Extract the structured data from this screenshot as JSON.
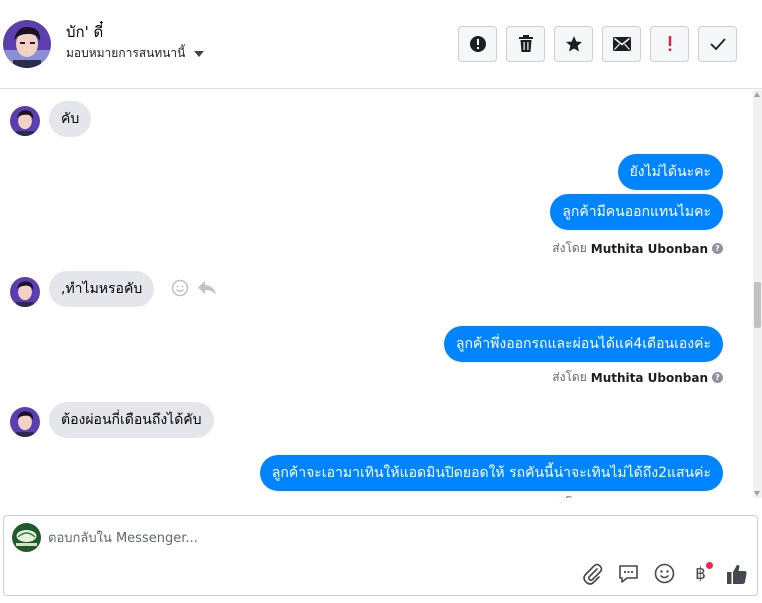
{
  "header": {
    "contact_name": "บัก' ดี๋",
    "assign_label": "มอบหมายการสนทนานี้",
    "actions": [
      {
        "icon": "alert-circle-icon",
        "name": "mark-spam-button"
      },
      {
        "icon": "trash-icon",
        "name": "delete-button"
      },
      {
        "icon": "star-icon",
        "name": "star-button"
      },
      {
        "icon": "envelope-icon",
        "name": "mark-unread-button"
      },
      {
        "icon": "exclamation-icon",
        "name": "follow-up-button"
      },
      {
        "icon": "check-icon",
        "name": "mark-done-button"
      }
    ]
  },
  "messages": [
    {
      "direction": "in",
      "text": "คับ"
    },
    {
      "direction": "out",
      "text": "ยังไม่ได้นะคะ"
    },
    {
      "direction": "out",
      "text": "ลูกค้ามีคนออกแทนไมคะ"
    },
    {
      "direction": "in",
      "text": ",ทำไมหรอคับ"
    },
    {
      "direction": "out",
      "text": "ลูกค้าพึ่งออกรถและผ่อนได้แค่4เดือนเองค่ะ"
    },
    {
      "direction": "in",
      "text": "ต้องผ่อนกี่เดือนถึงได้คับ"
    },
    {
      "direction": "out",
      "text": "ลูกค้าจะเอามาเทินให้แอดมินปิดยอดให้ รถคันนี้น่าจะเทินไม่ได้ถึง2แสนค่ะ"
    }
  ],
  "sent_by": {
    "prefix": "ส่งโดย",
    "name": "Muthita Ubonban",
    "info": "?"
  },
  "composer": {
    "placeholder": "ตอบกลับใน Messenger...",
    "tools": [
      "paperclip-icon",
      "speech-bubble-icon",
      "emoji-icon",
      "baht-payment-icon",
      "thumbs-up-icon"
    ],
    "baht_symbol": "฿"
  },
  "colors": {
    "outgoing_bubble": "#0084ff",
    "incoming_bubble": "#e4e6eb",
    "notification_dot": "#f02849"
  }
}
